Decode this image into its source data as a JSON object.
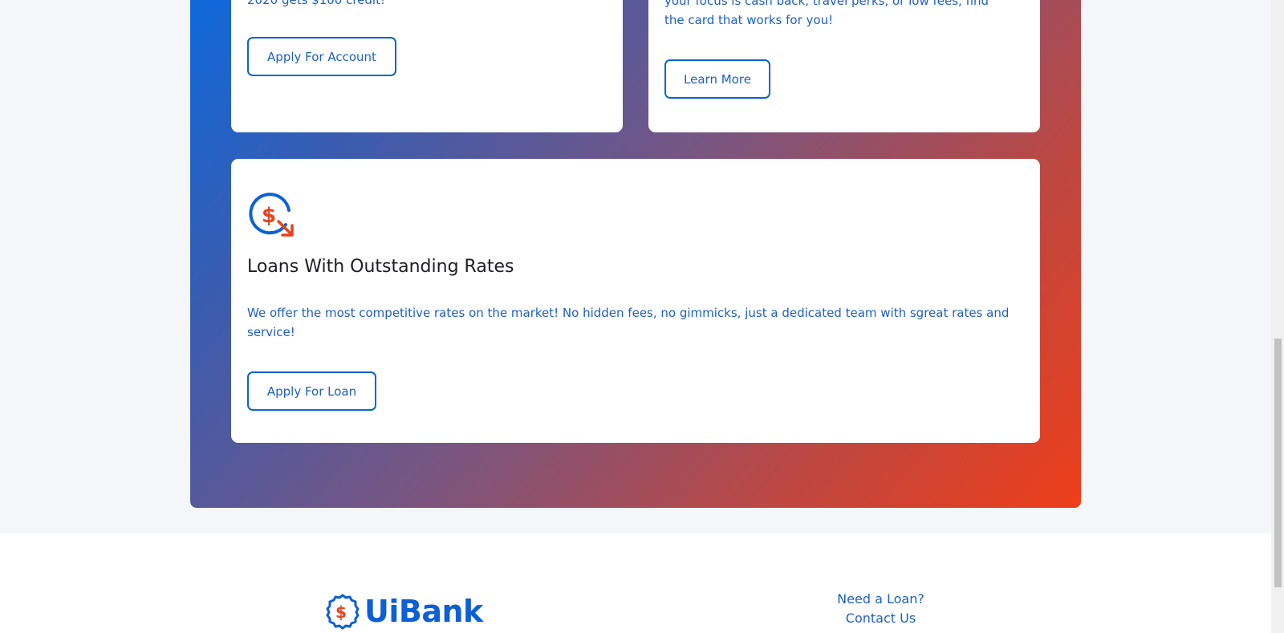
{
  "cards": {
    "account": {
      "text": "2020 gets $100 credit!",
      "button_label": "Apply For Account"
    },
    "credit_card": {
      "text_line1": "your focus is cash back, travel perks, or low fees, find",
      "text_line2": "the card that works for you!",
      "button_label": "Learn More"
    },
    "loans": {
      "icon": "dollar-down-arrow-icon",
      "title": "Loans With Outstanding Rates",
      "description": "We offer the most competitive rates on the market! No hidden fees, no gimmicks, just a dedicated team with sgreat rates and service!",
      "button_label": "Apply For Loan"
    }
  },
  "footer": {
    "logo_text": "UiBank",
    "links": [
      "Need a Loan?",
      "Contact Us"
    ]
  },
  "colors": {
    "accent_blue": "#0a63d4",
    "accent_orange": "#ee3e1a",
    "gradient_start": "#0a6ae0",
    "gradient_end": "#ee3e1a"
  }
}
